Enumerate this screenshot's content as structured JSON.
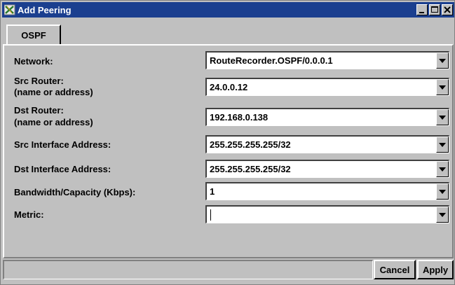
{
  "window": {
    "title": "Add Peering"
  },
  "tabs": [
    {
      "label": "OSPF"
    }
  ],
  "form": {
    "network": {
      "label": "Network:",
      "value": "RouteRecorder.OSPF/0.0.0.1"
    },
    "src_router": {
      "label_line1": "Src Router:",
      "label_line2": "(name or address)",
      "value": "24.0.0.12"
    },
    "dst_router": {
      "label_line1": "Dst Router:",
      "label_line2": "(name or address)",
      "value": "192.168.0.138"
    },
    "src_interface": {
      "label": "Src Interface Address:",
      "value": "255.255.255.255/32"
    },
    "dst_interface": {
      "label": "Dst Interface Address:",
      "value": "255.255.255.255/32"
    },
    "bandwidth": {
      "label": "Bandwidth/Capacity (Kbps):",
      "value": "1"
    },
    "metric": {
      "label": "Metric:",
      "value": ""
    }
  },
  "buttons": {
    "cancel": "Cancel",
    "apply": "Apply"
  },
  "colors": {
    "titlebar": "#1b3f8f",
    "face": "#c0c0c0"
  }
}
